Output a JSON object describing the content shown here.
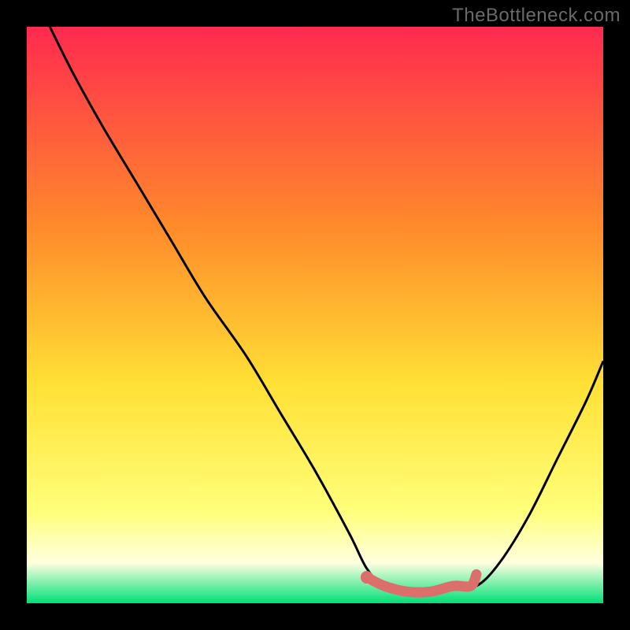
{
  "watermark": "TheBottleneck.com",
  "colors": {
    "grad_top": "#ff2a4f",
    "grad_mid1": "#ff8b2b",
    "grad_mid2": "#ffe035",
    "grad_low": "#ffff7a",
    "grad_pale": "#ffffe0",
    "grad_green": "#00e077",
    "curve": "#000000",
    "highlight": "#dc6e6b"
  },
  "chart_data": {
    "type": "line",
    "title": "",
    "xlabel": "",
    "ylabel": "",
    "xlim": [
      0,
      100
    ],
    "ylim": [
      0,
      100
    ],
    "series": [
      {
        "name": "curve",
        "x": [
          4,
          8,
          13,
          19,
          25,
          31,
          38,
          44,
          50,
          56,
          59,
          62,
          66,
          70,
          74,
          78,
          82,
          87,
          92,
          97,
          100
        ],
        "values": [
          100,
          92,
          83,
          73,
          63,
          53,
          43,
          33,
          23,
          12,
          6,
          3,
          2,
          2,
          3,
          3,
          7,
          15,
          25,
          35,
          42
        ]
      }
    ],
    "highlight": {
      "x": [
        59,
        62,
        66,
        70,
        74,
        77,
        78
      ],
      "values": [
        4.5,
        3,
        2,
        2,
        3,
        3,
        5
      ]
    }
  }
}
